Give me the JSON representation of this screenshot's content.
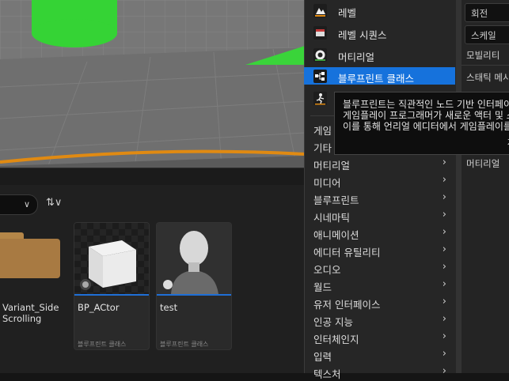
{
  "menu": {
    "items": [
      {
        "label": "레벨",
        "icon": "level-icon"
      },
      {
        "label": "레벨 시퀀스",
        "icon": "level-sequence-icon"
      },
      {
        "label": "머티리얼",
        "icon": "material-icon"
      },
      {
        "label": "블루프린트 클래스",
        "icon": "blueprint-class-icon",
        "selected": true
      },
      {
        "label": "",
        "icon": "character-icon"
      }
    ],
    "categories": [
      "게임",
      "기타",
      "머티리얼",
      "미디어",
      "블루프린트",
      "시네마틱",
      "애니메이션",
      "에디터 유틸리티",
      "오디오",
      "월드",
      "유저 인터페이스",
      "인공 지능",
      "인터체인지",
      "입력",
      "텍스처"
    ]
  },
  "tooltip": {
    "line1": "블루프린트는 직관적인 노드 기반 인터페이",
    "line2": "게임플레이 프로그래머가 새로운 액터 및 스",
    "line3": "이를 통해 언리얼 에디터에서 게임플레이를",
    "more": "자"
  },
  "details": {
    "rotation": "회전",
    "scale": "스케일",
    "mobility": "모빌리티",
    "static_mesh": "스태틱 메시",
    "material": "머티리얼"
  },
  "browser": {
    "folder_label": "Variant_Side\nScrolling",
    "assets": [
      {
        "name": "BP_ACtor",
        "type": "블루프린트 클래스",
        "thumb": "cube-icon"
      },
      {
        "name": "test",
        "type": "블루프린트 클래스",
        "thumb": "mannequin-icon"
      }
    ]
  },
  "colors": {
    "selection": "#1672dc",
    "green": "#3fd23f",
    "folder": "#a87a42"
  }
}
